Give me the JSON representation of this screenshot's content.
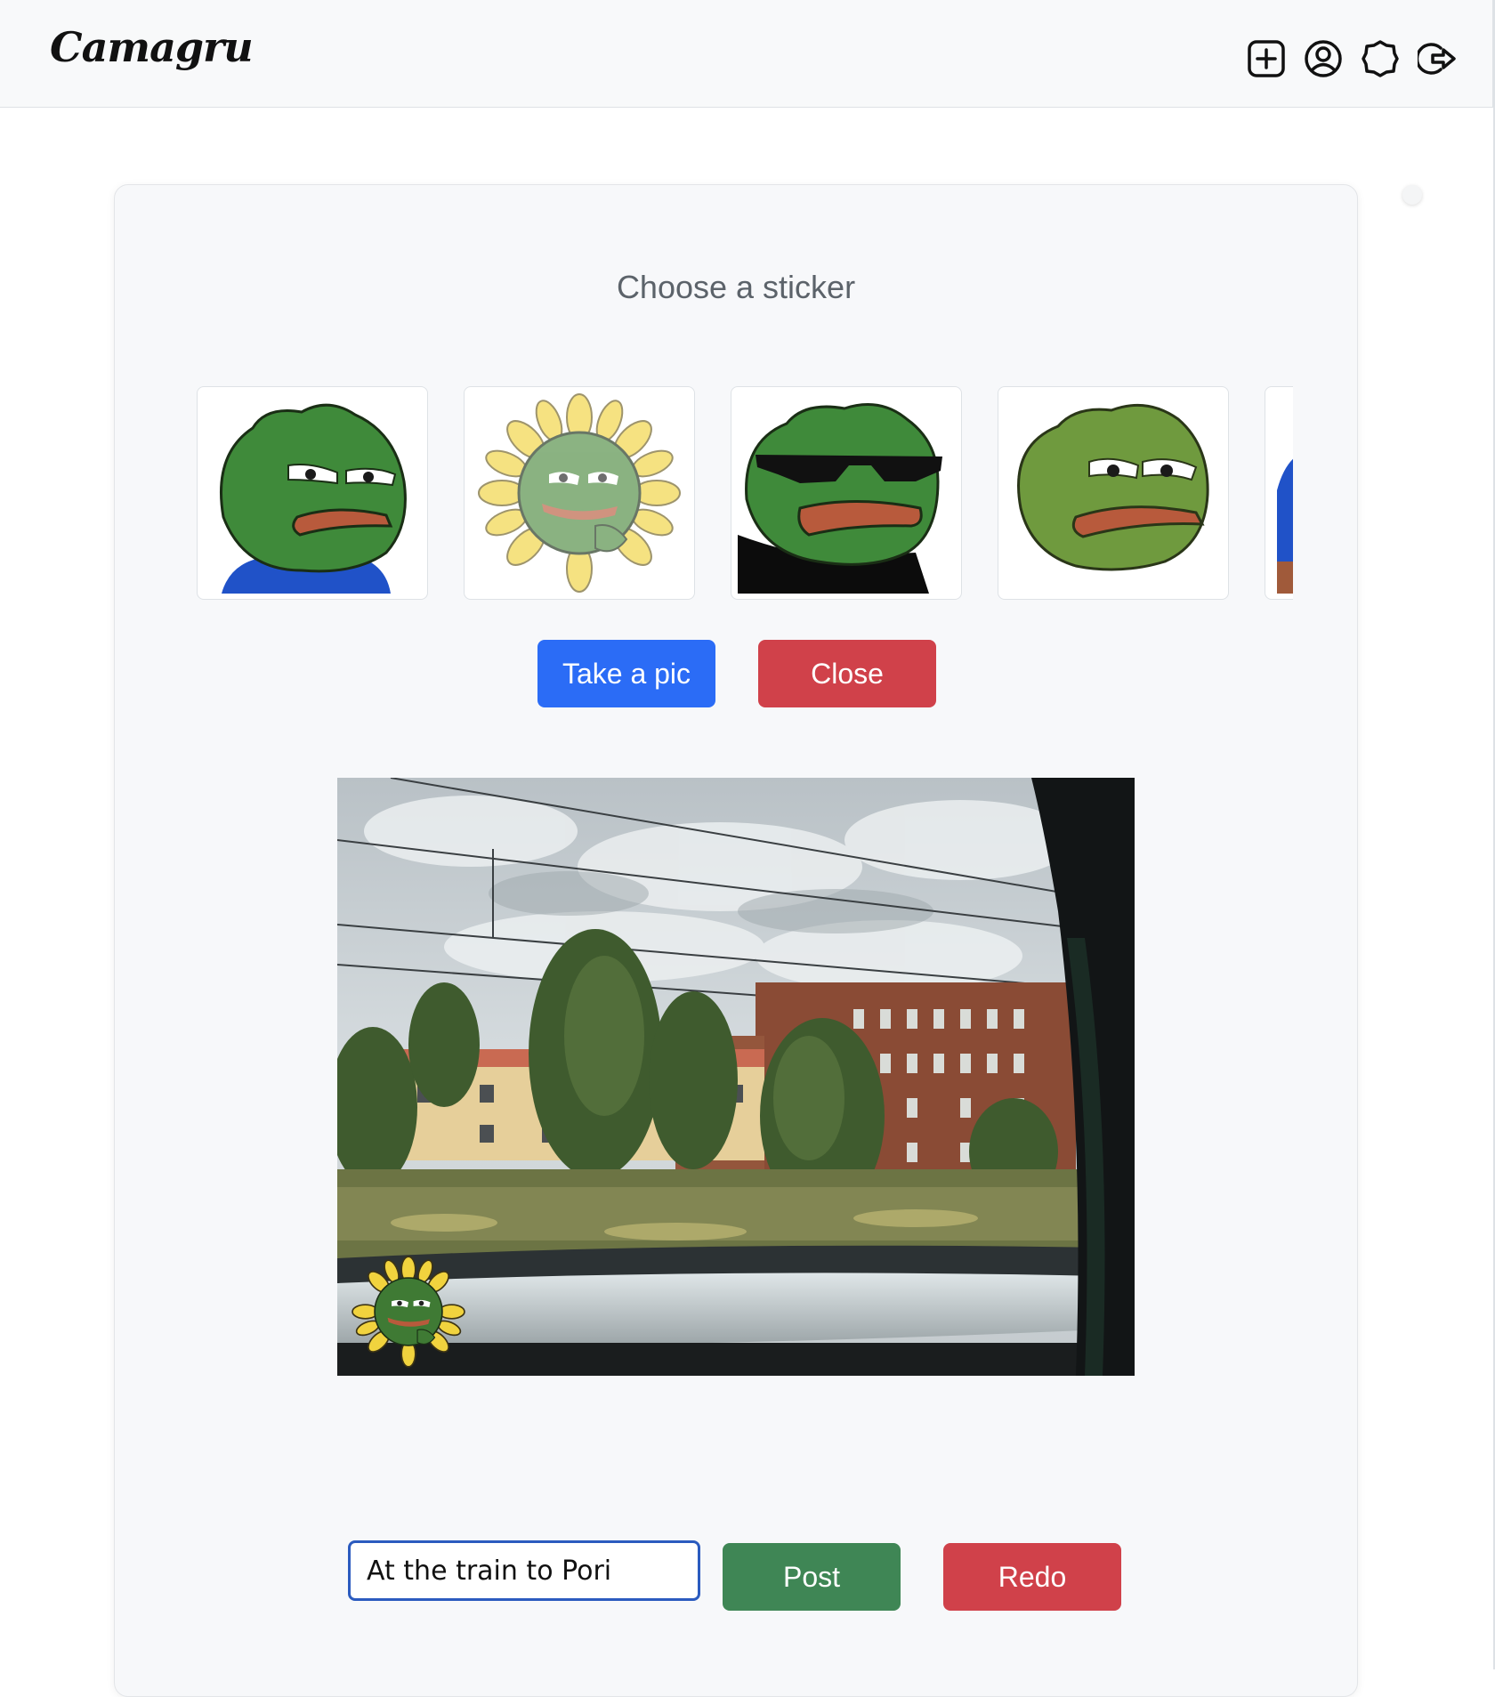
{
  "app": {
    "brand": "Camagru"
  },
  "nav": {
    "icons": [
      "plus-square-icon",
      "user-circle-icon",
      "gear-icon",
      "logout-icon"
    ]
  },
  "editor": {
    "title": "Choose a sticker",
    "stickers": [
      {
        "name": "pepe-sad-blue-shirt"
      },
      {
        "name": "pepe-sunflower"
      },
      {
        "name": "pepe-sunglasses"
      },
      {
        "name": "pepe-smug"
      },
      {
        "name": "pepe-partial"
      }
    ],
    "take_pic_label": "Take a pic",
    "close_label": "Close",
    "preview": {
      "sticker_applied": "pepe-sunflower"
    },
    "caption_value": "At the train to Pori",
    "post_label": "Post",
    "redo_label": "Redo"
  },
  "colors": {
    "primary": "#2b6cf6",
    "danger": "#d0414a",
    "success": "#3f8655"
  }
}
